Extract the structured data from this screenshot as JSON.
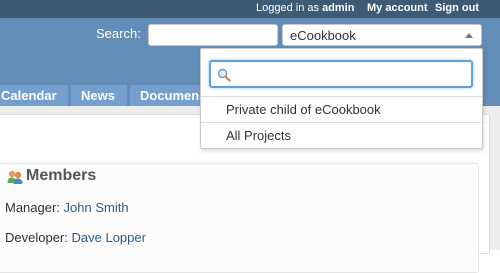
{
  "account": {
    "logged_in_prefix": "Logged in as",
    "username": "admin",
    "my_account": "My account",
    "sign_out": "Sign out"
  },
  "header": {
    "search_label": "Search:",
    "search_value": "",
    "project_selected": "eCookbook"
  },
  "menu": {
    "tabs": [
      {
        "label": "Calendar"
      },
      {
        "label": "News"
      },
      {
        "label": "Documen"
      }
    ]
  },
  "dropdown": {
    "search_value": "",
    "items": [
      {
        "label": "Private child of eCookbook"
      },
      {
        "label": "All Projects"
      }
    ]
  },
  "members": {
    "title": "Members",
    "roles": [
      {
        "role": "Manager:",
        "name": "John Smith"
      },
      {
        "role": "Developer:",
        "name": "Dave Lopper"
      }
    ]
  },
  "colors": {
    "top_bar": "#3e5b76",
    "header": "#628db6",
    "tab": "#759fcf",
    "focus": "#5ba3dc",
    "link": "#2a5a8a"
  }
}
